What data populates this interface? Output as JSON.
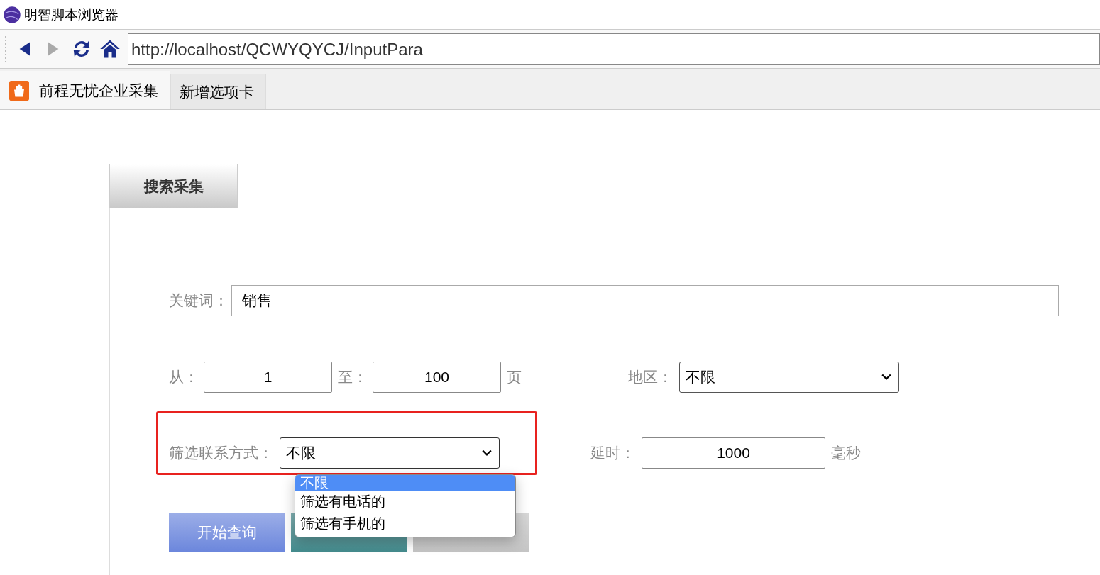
{
  "window": {
    "title": "明智脚本浏览器"
  },
  "toolbar": {
    "back_disabled": false,
    "forward_disabled": true,
    "url": "http://localhost/QCWYQYCJ/InputPara"
  },
  "browser_tabs": [
    {
      "label": "前程无忧企业采集",
      "selected": true,
      "has_icon": true
    },
    {
      "label": "新增选项卡",
      "selected": false,
      "has_icon": false
    }
  ],
  "panel": {
    "tab": "搜索采集",
    "keyword": {
      "label": "关键词：",
      "value": "销售"
    },
    "page_from": {
      "label": "从：",
      "value": "1"
    },
    "page_to": {
      "label": "至：",
      "value": "100",
      "unit": "页"
    },
    "region": {
      "label": "地区：",
      "value": "不限"
    },
    "contact_filter": {
      "label": "筛选联系方式：",
      "value": "不限",
      "highlighted": true,
      "expanded": true,
      "options": [
        {
          "label": "不限",
          "selected": true
        },
        {
          "label": "筛选有电话的",
          "selected": false
        },
        {
          "label": "筛选有手机的",
          "selected": false
        }
      ]
    },
    "delay": {
      "label": "延时：",
      "value": "1000",
      "unit": "毫秒"
    },
    "buttons": [
      {
        "label": "开始查询",
        "color": "#6b86dc"
      },
      {
        "color": "#438b8d"
      },
      {
        "color": "#c4c4c4"
      }
    ]
  }
}
